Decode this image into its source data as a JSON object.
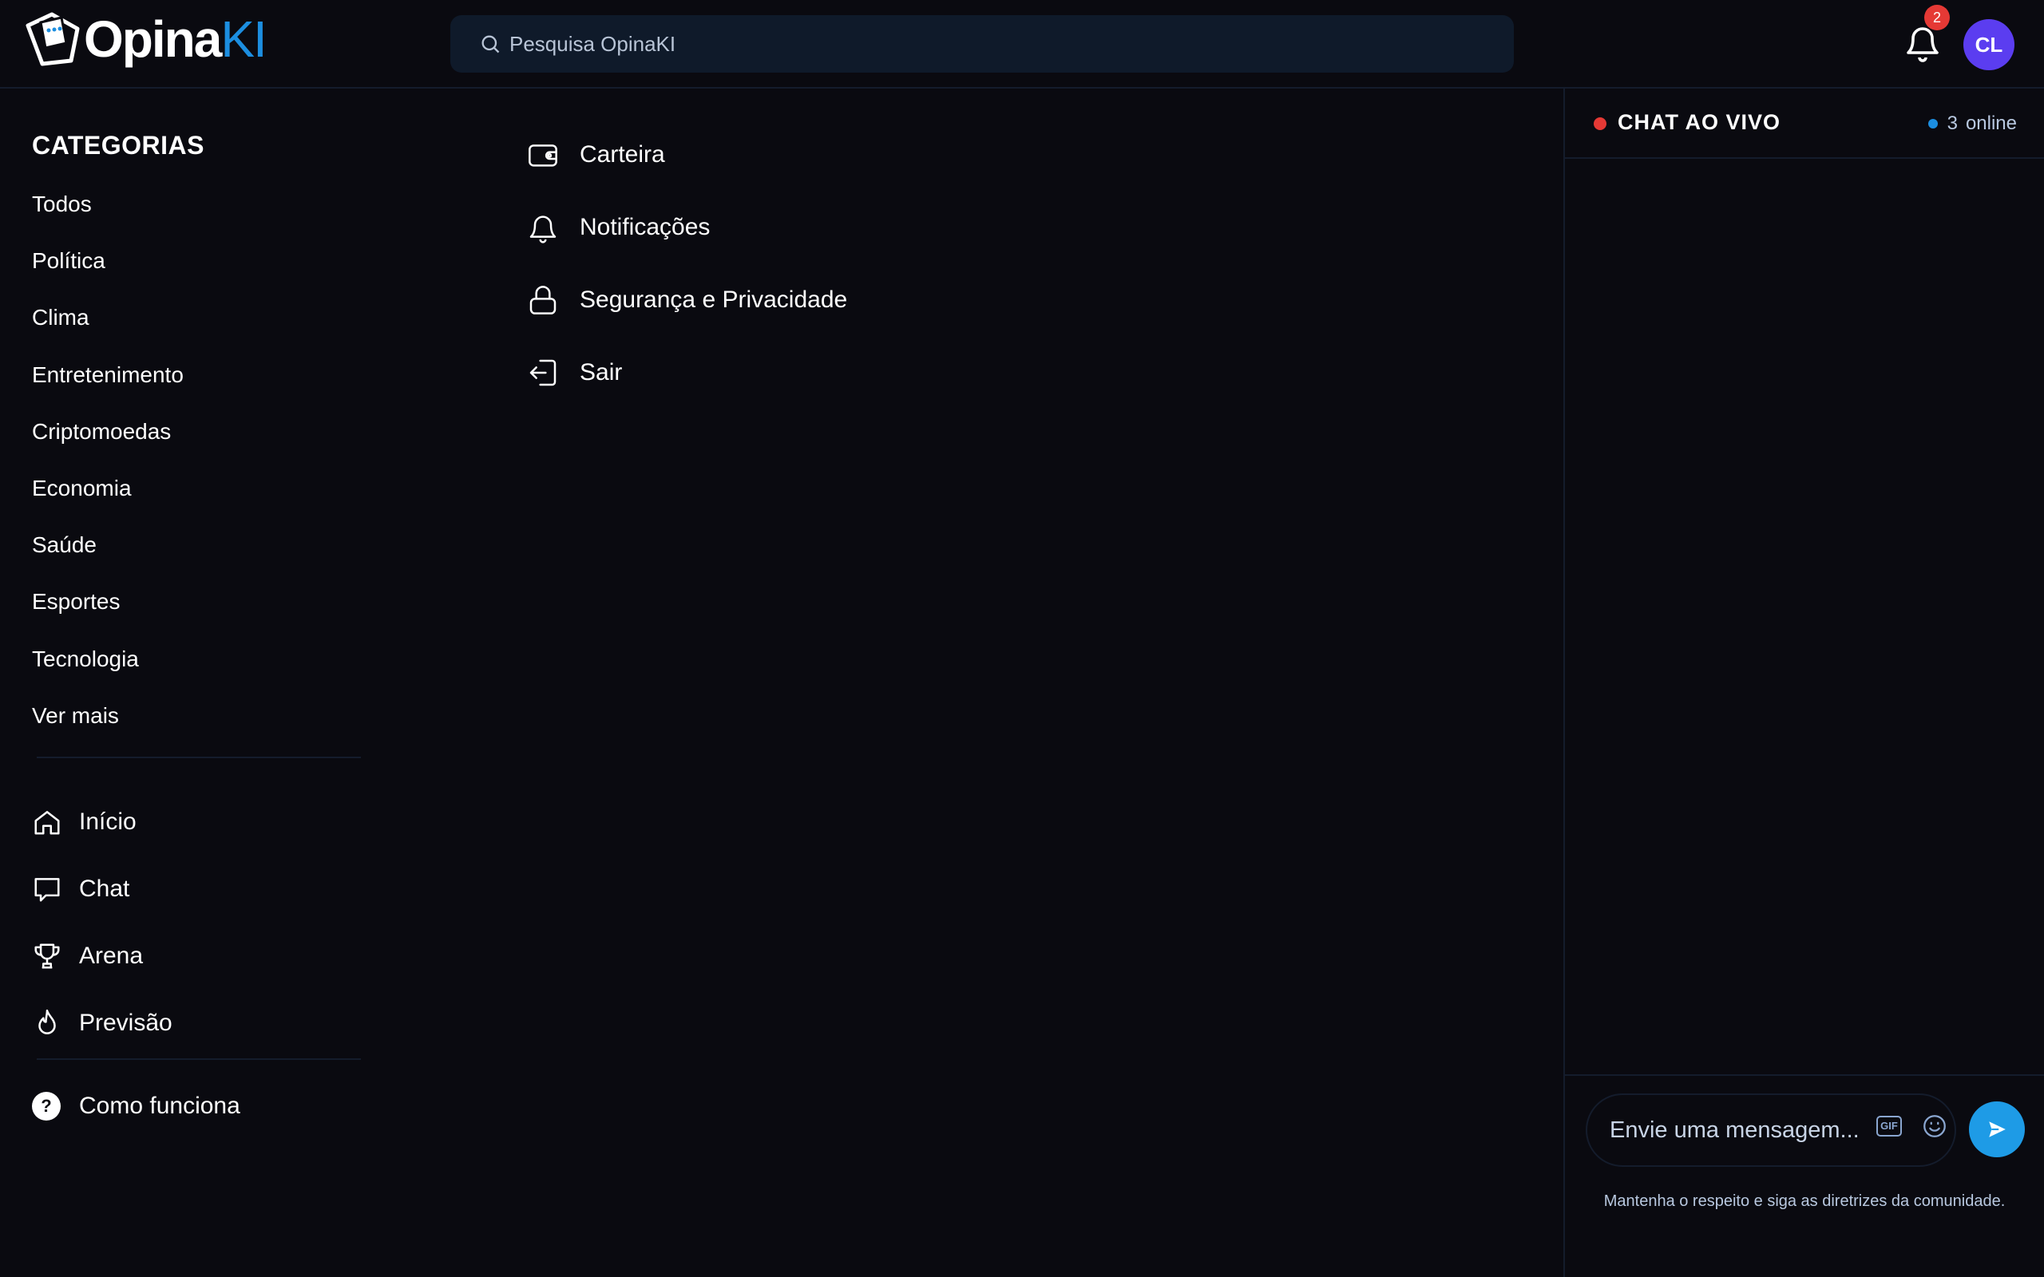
{
  "header": {
    "logo": {
      "text_main": "Opina",
      "text_accent": "KI"
    },
    "search": {
      "placeholder": "Pesquisa OpinaKI"
    },
    "notifications": {
      "count": "2"
    },
    "user": {
      "initials": "CL"
    }
  },
  "sidebar": {
    "categories_title": "CATEGORIAS",
    "categories": [
      "Todos",
      "Política",
      "Clima",
      "Entretenimento",
      "Criptomoedas",
      "Economia",
      "Saúde",
      "Esportes",
      "Tecnologia",
      "Ver mais"
    ],
    "nav": [
      {
        "label": "Início",
        "icon": "home-icon"
      },
      {
        "label": "Chat",
        "icon": "chat-icon"
      },
      {
        "label": "Arena",
        "icon": "trophy-icon"
      },
      {
        "label": "Previsão",
        "icon": "flame-icon"
      }
    ],
    "help": {
      "label": "Como funciona",
      "icon": "question-icon",
      "glyph": "?"
    }
  },
  "menu": {
    "items": [
      {
        "label": "Carteira",
        "icon": "wallet-icon"
      },
      {
        "label": "Notificações",
        "icon": "bell-icon"
      },
      {
        "label": "Segurança e Privacidade",
        "icon": "lock-icon"
      },
      {
        "label": "Sair",
        "icon": "logout-icon"
      }
    ]
  },
  "chat": {
    "title": "CHAT AO VIVO",
    "online_count": "3",
    "online_label": "online",
    "input_placeholder": "Envie uma mensagem...",
    "gif_label": "GIF",
    "guidelines": "Mantenha o respeito e siga as diretrizes da comunidade."
  },
  "colors": {
    "background": "#0a0a10",
    "accent": "#1c8ee0",
    "live": "#e53935",
    "avatar": "#5b3df0"
  }
}
